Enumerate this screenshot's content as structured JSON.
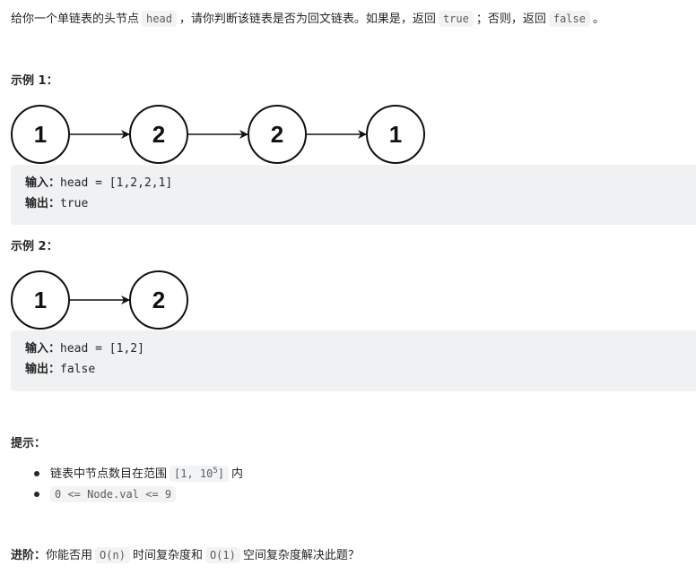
{
  "description": {
    "parts": [
      {
        "type": "text",
        "value": "给你一个单链表的头节点"
      },
      {
        "type": "code",
        "value": "head"
      },
      {
        "type": "text",
        "value": "，请你判断该链表是否为回文链表。如果是，返回"
      },
      {
        "type": "code",
        "value": "true"
      },
      {
        "type": "text",
        "value": "；否则，返回"
      },
      {
        "type": "code",
        "value": "false"
      },
      {
        "type": "text",
        "value": "。"
      }
    ]
  },
  "examples": [
    {
      "title": "示例 1：",
      "nodes": [
        "1",
        "2",
        "2",
        "1"
      ],
      "input_label": "输入：",
      "input_value": "head = [1,2,2,1]",
      "output_label": "输出：",
      "output_value": "true"
    },
    {
      "title": "示例 2：",
      "nodes": [
        "1",
        "2"
      ],
      "input_label": "输入：",
      "input_value": "head = [1,2]",
      "output_label": "输出：",
      "output_value": "false"
    }
  ],
  "hints": {
    "title": "提示：",
    "items": [
      {
        "prefix": "链表中节点数目在范围",
        "code_base": "[1, 10",
        "code_sup": "5",
        "code_end": "]",
        "suffix": "内"
      },
      {
        "code": "0 <= Node.val <= 9"
      }
    ]
  },
  "followup": {
    "label": "进阶：",
    "text1": "你能否用",
    "code1": "O(n)",
    "text2": "时间复杂度和",
    "code2": "O(1)",
    "text3": "空间复杂度解决此题？"
  },
  "colors": {
    "text": "#262626",
    "code_bg": "#f2f3f5",
    "example_bg": "#f0f1f3",
    "node_stroke": "#111111"
  }
}
